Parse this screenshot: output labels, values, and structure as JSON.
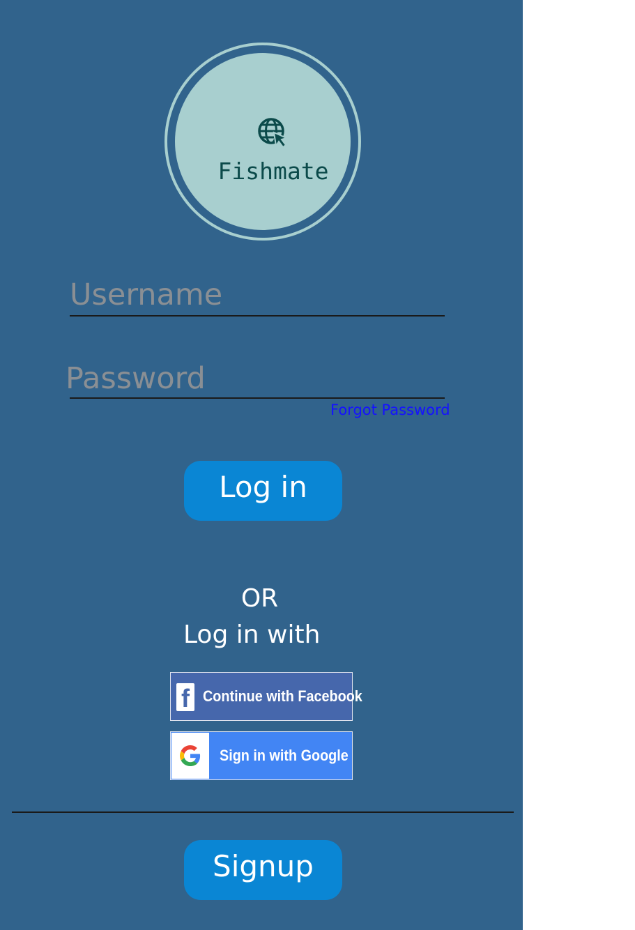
{
  "app": {
    "name": "Fishmate",
    "logo_icon": "globe-cursor-icon"
  },
  "login_form": {
    "username_placeholder": "Username",
    "password_placeholder": "Password",
    "forgot_password_label": "Forgot Password",
    "login_button_label": "Log in"
  },
  "alternate_login": {
    "or_text": "OR",
    "login_with_text": "Log in with",
    "facebook_button_label": "Continue with Facebook",
    "google_button_label": "Sign in with Google"
  },
  "signup": {
    "button_label": "Signup"
  },
  "colors": {
    "panel_background": "#31638c",
    "logo_background": "#a8cfcf",
    "primary_button": "#0a86d4",
    "link": "#1512ff",
    "facebook": "#4667ac",
    "google": "#4285f4"
  }
}
